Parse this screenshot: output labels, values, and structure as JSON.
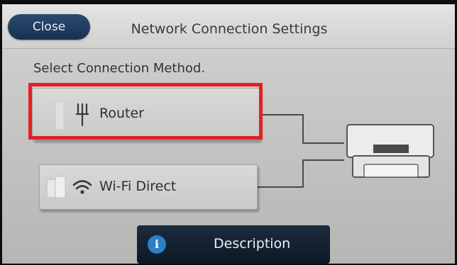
{
  "header": {
    "close_label": "Close",
    "title": "Network Connection Settings"
  },
  "main": {
    "instruction": "Select Connection Method.",
    "options": [
      {
        "label": "Router",
        "icon": "router-antenna-icon",
        "highlighted": true
      },
      {
        "label": "Wi-Fi Direct",
        "icon": "wifi-icon",
        "highlighted": false
      }
    ]
  },
  "footer": {
    "description_label": "Description",
    "info_glyph": "i"
  },
  "colors": {
    "highlight": "#e41f26",
    "close_button": "#1f3c5e",
    "description_button": "#12202f",
    "info_icon": "#2e7fc4"
  }
}
